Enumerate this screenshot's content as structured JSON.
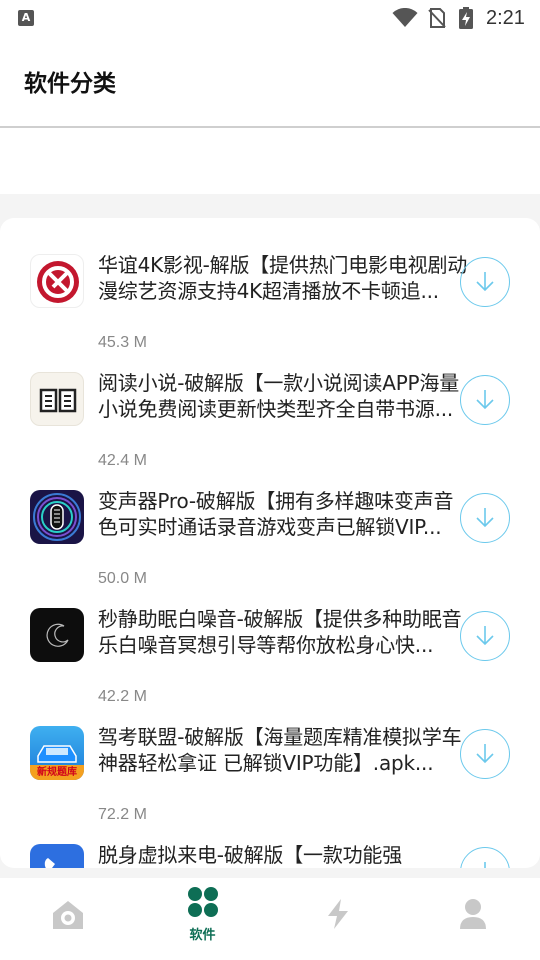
{
  "status_bar": {
    "left_icon": "A",
    "time": "2:21",
    "icons": [
      "notification-a-icon",
      "wifi-icon",
      "no-sim-icon",
      "battery-charging-icon"
    ]
  },
  "header": {
    "title": "软件分类"
  },
  "apps": [
    {
      "icon": "huayi-4k-app-icon",
      "title": "华谊4K影视-解版【提供热门电影电视剧动漫综艺资源支持4K超清播放不卡顿追...",
      "size": "45.3 M"
    },
    {
      "icon": "book-app-icon",
      "title": "阅读小说-破解版【一款小说阅读APP海量小说免费阅读更新快类型齐全自带书源...",
      "size": "42.4 M"
    },
    {
      "icon": "voice-changer-app-icon",
      "title": "变声器Pro-破解版【拥有多样趣味变声音色可实时通话录音游戏变声已解锁VIP...",
      "size": "50.0 M"
    },
    {
      "icon": "moon-app-icon",
      "title": "秒静助眠白噪音-破解版【提供多种助眠音乐白噪音冥想引导等帮你放松身心快...",
      "size": "42.2 M"
    },
    {
      "icon": "car-exam-app-icon",
      "icon_text": "新规题库",
      "title": "驾考联盟-破解版【海量题库精准模拟学车神器轻松拿证 已解锁VIP功能】.apk...",
      "size": "72.2 M"
    },
    {
      "icon": "phone-app-icon",
      "title": "脱身虚拟来电-破解版【一款功能强",
      "size": ""
    }
  ],
  "bottom_nav": {
    "items": [
      {
        "name": "home",
        "icon": "home-icon",
        "label": ""
      },
      {
        "name": "software",
        "icon": "grid-icon",
        "label": "软件",
        "active": true
      },
      {
        "name": "flash",
        "icon": "lightning-icon",
        "label": ""
      },
      {
        "name": "profile",
        "icon": "user-icon",
        "label": ""
      }
    ]
  },
  "colors": {
    "accent": "#0e6e55",
    "download_ring": "#6cc9ec",
    "inactive_icon": "#c8c8c8"
  }
}
